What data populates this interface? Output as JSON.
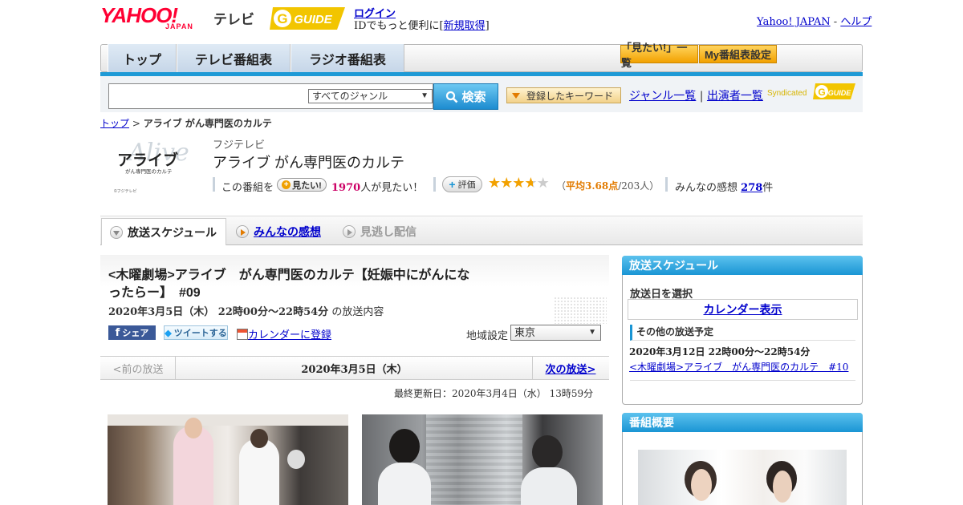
{
  "header": {
    "yahoo_logo": "YAHOO!",
    "japan_logo": "JAPAN",
    "tv_label": "テレビ",
    "gguide_logo": "GUIDE",
    "login_link": "ログイン",
    "login_sub_prefix": "IDでもっと便利に[",
    "signup_link": "新規取得",
    "login_sub_suffix": "]",
    "yahoo_japan_link": "Yahoo! JAPAN",
    "separator": "-",
    "help_link": "ヘルプ"
  },
  "nav": {
    "tabs": [
      "トップ",
      "テレビ番組表",
      "ラジオ番組表"
    ],
    "mitai_list_button": "「見たい!」一覧",
    "my_schedule_button": "My番組表設定"
  },
  "search": {
    "genre_selected": "すべてのジャンル",
    "search_button": "検索",
    "keyword_button": "登録したキーワード",
    "genre_list_link": "ジャンル一覧",
    "divider": "|",
    "cast_list_link": "出演者一覧",
    "syndicated": "Syndicated"
  },
  "breadcrumb": {
    "top_link": "トップ",
    "sep": ">",
    "current": "アライブ がん専門医のカルテ"
  },
  "program": {
    "logo_main": "アライブ",
    "logo_sub": "がん専門医のカルテ",
    "logo_script": "Alive",
    "logo_credit": "©フジテレビ",
    "station": "フジテレビ",
    "title": "アライブ がん専門医のカルテ",
    "mitai_prefix": "この番組を",
    "mitai_button": "見たい!",
    "mitai_count": "1970",
    "mitai_suffix": "人が見たい！",
    "rating_button": "評価",
    "rating_stars": 3.68,
    "rating_open": "（",
    "rating_avg": "平均3.68点",
    "rating_people": "/203人）",
    "reviews_label": "みんなの感想",
    "reviews_count": "278",
    "reviews_suffix": "件"
  },
  "tabs": {
    "schedule": "放送スケジュール",
    "reviews": "みんなの感想",
    "vod": "見逃し配信"
  },
  "episode": {
    "title": "<木曜劇場>アライブ　がん専門医のカルテ【妊娠中にがんになったらー】　#09",
    "datetime": "2020年3月5日（木）  22時00分～22時54分",
    "datetime_suffix": "の放送内容",
    "share_fb": "シェア",
    "share_tw": "ツイートする",
    "calendar_register": "カレンダーに登録",
    "region_label": "地域設定",
    "region_value": "東京",
    "prev": "<前の放送",
    "current_date": "2020年3月5日（木）",
    "next": "次の放送>",
    "updated": "最終更新日：2020年3月4日（水）  13時59分"
  },
  "sidebar": {
    "schedule_header": "放送スケジュール",
    "select_date": "放送日を選択",
    "calendar_button": "カレンダー表示",
    "other_schedule": "その他の放送予定",
    "next_date": "2020年3月12日  22時00分～22時54分",
    "next_link": "<木曜劇場>アライブ　がん専門医のカルテ　#10",
    "overview_header": "番組概要"
  },
  "colors": {
    "accent_blue": "#1a95d4",
    "yahoo_red": "#ff0033",
    "gguide_yellow": "#f2c500",
    "mitai_pink": "#cc0066",
    "rating_orange": "#e27b00",
    "star_gold": "#f2a100"
  }
}
